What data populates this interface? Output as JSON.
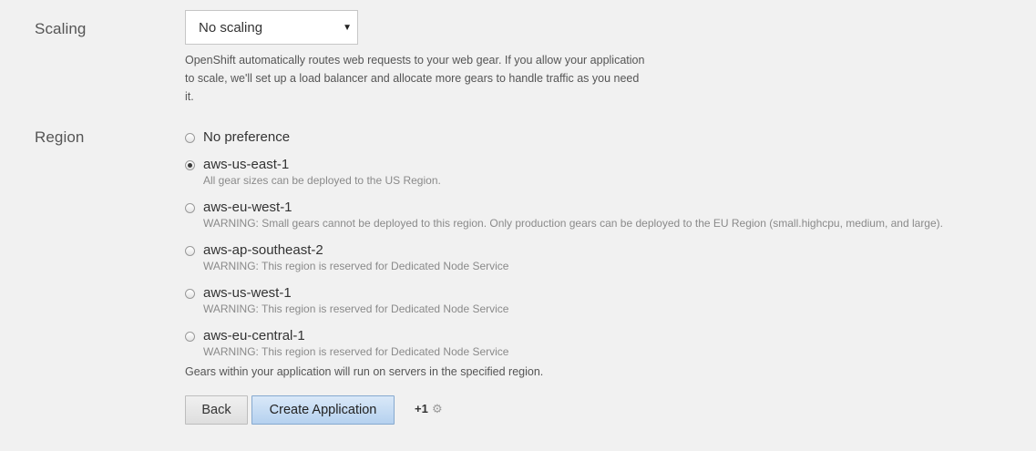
{
  "scaling": {
    "label": "Scaling",
    "selected_option": "No scaling",
    "help": "OpenShift automatically routes web requests to your web gear. If you allow your application to scale, we'll set up a load balancer and allocate more gears to handle traffic as you need it."
  },
  "region": {
    "label": "Region",
    "options": [
      {
        "label": "No preference",
        "description": "",
        "checked": false
      },
      {
        "label": "aws-us-east-1",
        "description": "All gear sizes can be deployed to the US Region.",
        "checked": true
      },
      {
        "label": "aws-eu-west-1",
        "description": "WARNING: Small gears cannot be deployed to this region. Only production gears can be deployed to the EU Region (small.highcpu, medium, and large).",
        "checked": false
      },
      {
        "label": "aws-ap-southeast-2",
        "description": "WARNING: This region is reserved for Dedicated Node Service",
        "checked": false
      },
      {
        "label": "aws-us-west-1",
        "description": "WARNING: This region is reserved for Dedicated Node Service",
        "checked": false
      },
      {
        "label": "aws-eu-central-1",
        "description": "WARNING: This region is reserved for Dedicated Node Service",
        "checked": false
      }
    ],
    "help": "Gears within your application will run on servers in the specified region."
  },
  "actions": {
    "back_label": "Back",
    "create_label": "Create Application",
    "plus_one_label": "+1",
    "gear_icon": "gear-icon"
  },
  "colors": {
    "background": "#f1f1f1",
    "primary_button": "#c6dcf4",
    "primary_button_border": "#86a9cf"
  }
}
